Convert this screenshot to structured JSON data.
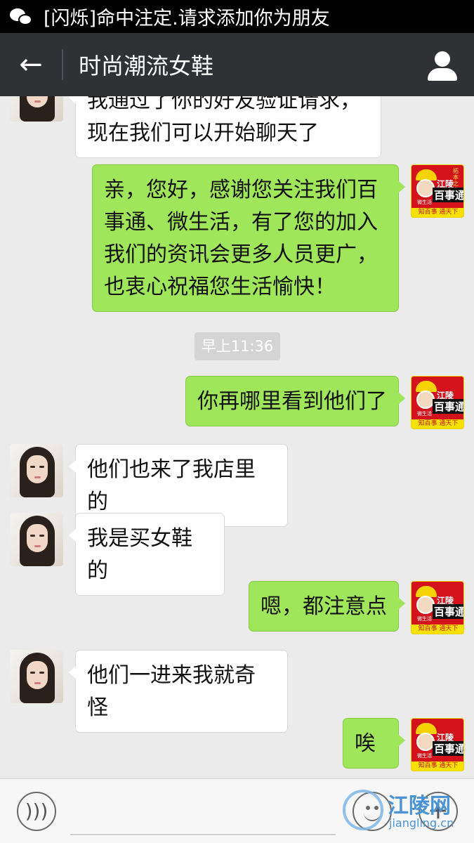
{
  "notification": {
    "app_icon": "wechat-icon",
    "text": "[闪烁]命中注定.请求添加你为朋友"
  },
  "header": {
    "back_icon": "arrow-left-icon",
    "title": "时尚潮流女鞋",
    "profile_icon": "user-icon"
  },
  "messages": [
    {
      "side": "in",
      "text": "我通过了你的好友验证请求，现在我们可以开始聊天了"
    },
    {
      "side": "out",
      "text": "亲，您好，感谢您关注我们百事通、微生活，有了您的加入我们的资讯会更多人员更广，也衷心祝福您生活愉快！"
    },
    {
      "side": "out",
      "text": "你再哪里看到他们了"
    },
    {
      "side": "in",
      "text": "他们也来了我店里的"
    },
    {
      "side": "in",
      "text": "我是买女鞋的"
    },
    {
      "side": "out",
      "text": "嗯，都注意点"
    },
    {
      "side": "in",
      "text": "他们一进来我就奇怪"
    },
    {
      "side": "out",
      "text": "唉"
    }
  ],
  "timestamp": "早上11:36",
  "shop_avatar": {
    "town": "江陵",
    "brand": "百事通",
    "small": "微生活",
    "strip": "知百事 通天下"
  },
  "composer": {
    "voice_icon": "voice-icon",
    "emoji_icon": "emoji-icon",
    "plus_icon": "plus-icon"
  },
  "watermark": {
    "cn": "江陵网",
    "en": "jiangling.cn"
  },
  "colors": {
    "header_bg": "#2f3134",
    "chat_bg": "#ebebeb",
    "out_bubble": "#9fe65a",
    "in_bubble": "#ffffff"
  }
}
